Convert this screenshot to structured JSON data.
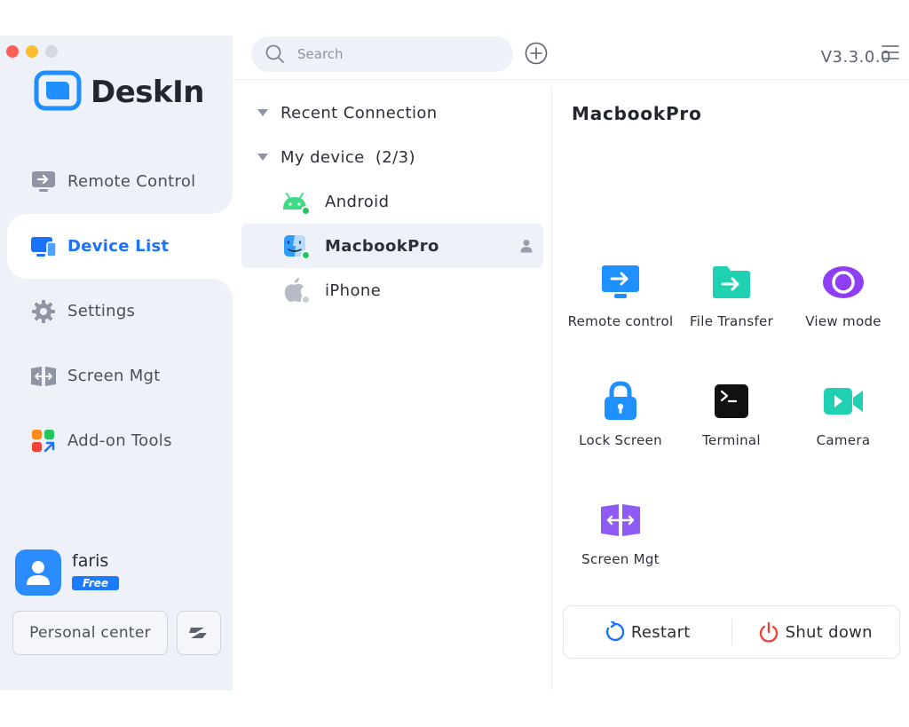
{
  "app": {
    "version": "V3.3.0.0",
    "brand_name": "DeskIn"
  },
  "sidebar": {
    "nav": [
      {
        "label": "Remote Control",
        "icon": "monitor-arrow-icon",
        "active": false
      },
      {
        "label": "Device List",
        "icon": "device-list-icon",
        "active": true
      },
      {
        "label": "Settings",
        "icon": "gear-icon",
        "active": false
      },
      {
        "label": "Screen Mgt",
        "icon": "screen-mgt-icon",
        "active": false
      },
      {
        "label": "Add-on Tools",
        "icon": "addon-tools-icon",
        "active": false
      }
    ],
    "user": {
      "name": "faris",
      "plan": "Free"
    },
    "personal_center_label": "Personal center"
  },
  "search": {
    "placeholder": "Search"
  },
  "tree": {
    "recent_label": "Recent Connection",
    "my_device_label": "My device  (2/3)",
    "devices": [
      {
        "name": "Android",
        "icon": "android-icon",
        "online": true
      },
      {
        "name": "MacbookPro",
        "icon": "finder-icon",
        "online": true,
        "selected": true
      },
      {
        "name": "iPhone",
        "icon": "apple-icon",
        "online": false
      }
    ]
  },
  "detail": {
    "title": "MacbookPro",
    "actions": [
      {
        "label": "Remote control",
        "icon": "remote-control-icon"
      },
      {
        "label": "File Transfer",
        "icon": "file-transfer-icon"
      },
      {
        "label": "View mode",
        "icon": "view-mode-icon"
      },
      {
        "label": "Lock Screen",
        "icon": "lock-icon"
      },
      {
        "label": "Terminal",
        "icon": "terminal-icon"
      },
      {
        "label": "Camera",
        "icon": "camera-icon"
      },
      {
        "label": "Screen Mgt",
        "icon": "screen-mgt-icon"
      }
    ],
    "restart_label": "Restart",
    "shutdown_label": "Shut down"
  },
  "colors": {
    "accent": "#1a73ff",
    "sidebar_bg": "#eef1f8",
    "online": "#22c55e",
    "shutdown": "#f04438"
  }
}
